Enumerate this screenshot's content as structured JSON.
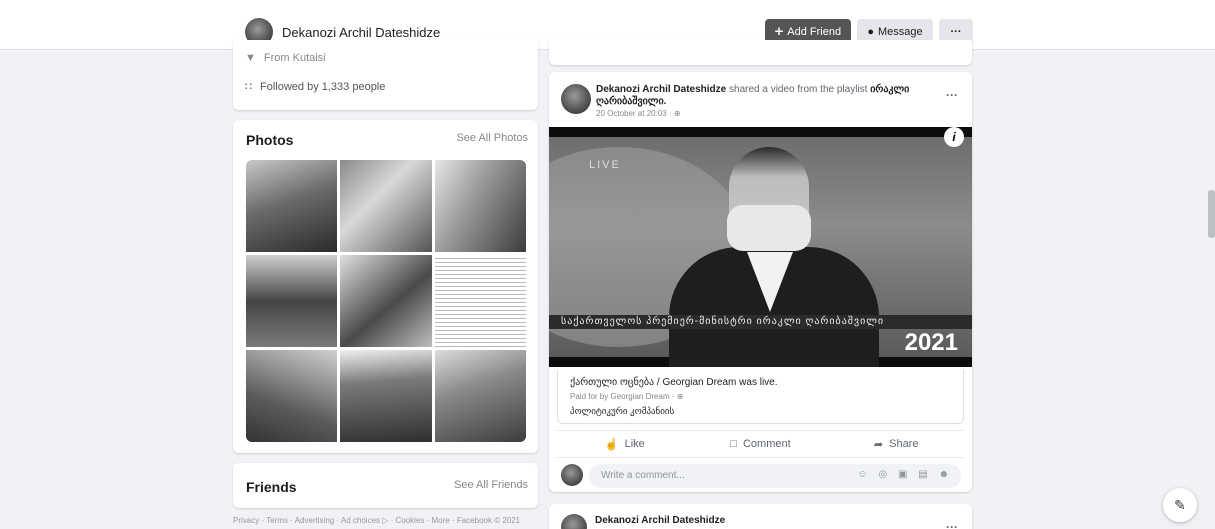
{
  "header": {
    "profile_name": "Dekanozi Archil Dateshidze",
    "add_friend_label": "Add Friend",
    "message_label": "Message",
    "more_label": "···"
  },
  "intro": {
    "from_text": "From Kutaisi",
    "followed_text": "Followed by 1,333 people"
  },
  "photos": {
    "title": "Photos",
    "see_all": "See All Photos"
  },
  "friends": {
    "title": "Friends",
    "see_all": "See All Friends"
  },
  "footer": {
    "text": "Privacy · Terms · Advertising · Ad choices ▷ · Cookies · More · Facebook © 2021"
  },
  "post": {
    "author": "Dekanozi Archil Dateshidze",
    "shared_text": " shared a video from the playlist ",
    "playlist": "ირაკლი ღარიბაშვილი.",
    "timestamp": "20 October at 20:03 · ⊕",
    "more": "···",
    "video": {
      "live_tag": "LIVE",
      "ticker": "საქართველოს პრემიერ-მინისტრი ირაკლი ღარიბაშვილი",
      "year": "2021",
      "info": "i"
    },
    "embed": {
      "page_line": "ქართული ოცნება / Georgian Dream was live.",
      "paid_line": "Paid for by Georgian Dream · ⊕",
      "caption": "პოლიტიკური კომპანიის"
    },
    "actions": {
      "like": "Like",
      "comment": "Comment",
      "share": "Share"
    },
    "comment_placeholder": "Write a comment...",
    "comment_icons": "☺ ◎ ▣ ▤ ☻"
  },
  "next_post": {
    "author": "Dekanozi Archil Dateshidze",
    "more": "···"
  },
  "fab_icon": "✎"
}
